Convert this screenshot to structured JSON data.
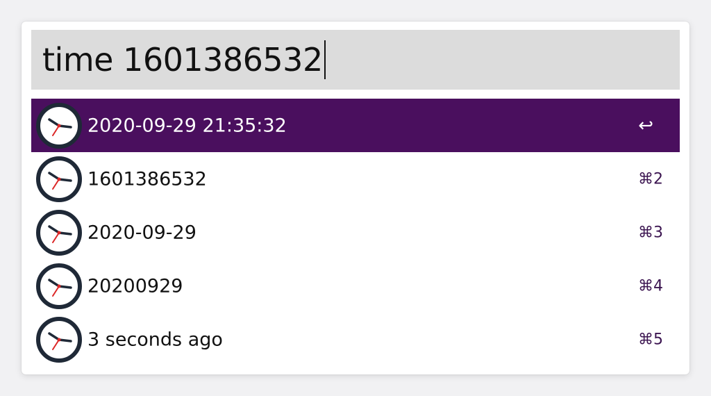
{
  "search": {
    "query": "time 1601386532"
  },
  "results": [
    {
      "label": "2020-09-29 21:35:32",
      "shortcut": "↩",
      "icon": "clock-icon",
      "selected": true
    },
    {
      "label": "1601386532",
      "shortcut": "⌘2",
      "icon": "clock-icon",
      "selected": false
    },
    {
      "label": "2020-09-29",
      "shortcut": "⌘3",
      "icon": "clock-icon",
      "selected": false
    },
    {
      "label": "20200929",
      "shortcut": "⌘4",
      "icon": "clock-icon",
      "selected": false
    },
    {
      "label": "3 seconds ago",
      "shortcut": "⌘5",
      "icon": "clock-icon",
      "selected": false
    }
  ],
  "colors": {
    "selection": "#4a0f5e",
    "search_background": "#dcdcdc",
    "clock_border": "#1f2937",
    "clock_second_hand": "#dc2626"
  }
}
